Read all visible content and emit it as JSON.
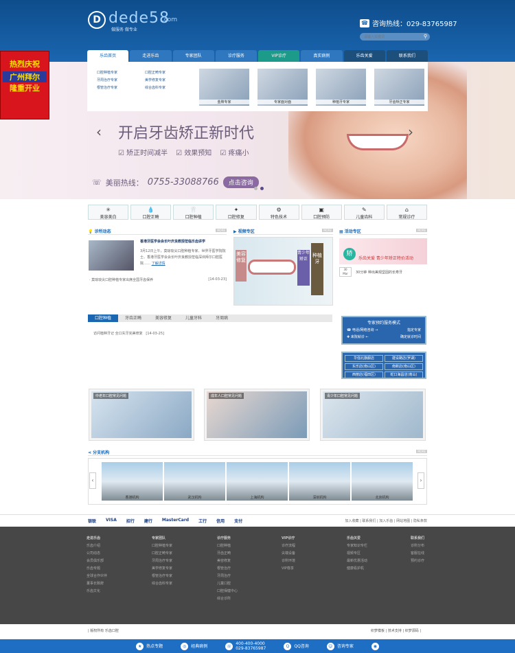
{
  "header": {
    "logo_mark": "D",
    "logo_text": "dede58",
    "logo_domain": ".com",
    "logo_slogan": "做服务 做专业",
    "hotline_label": "咨询热线：029-83765987",
    "search_placeholder": "请输入关键词"
  },
  "nav": [
    "乐齿首页",
    "走进乐齿",
    "专家团队",
    "诊疗服务",
    "VIP诊疗",
    "真实病例",
    "乐齿关爱",
    "联系我们"
  ],
  "dropdown": {
    "links": [
      "口腔种植专家",
      "口腔正畸专家",
      "牙周治疗专家",
      "美学修复专家",
      "根管治疗专家",
      "综合齿科专家"
    ],
    "images": [
      "金牌专家",
      "专家面对面",
      "种植牙专家",
      "牙齿矫正专家"
    ]
  },
  "side_ad": {
    "line1": "热烈庆祝",
    "line2": "广州拜尔",
    "line3": "隆重开业"
  },
  "banner": {
    "title": "开启牙齿矫正新时代",
    "features": [
      "矫正时间减半",
      "效果预知",
      "疼痛小"
    ],
    "hot_label": "美丽热线：",
    "hot_number": "0755-33088766",
    "consult": "点击咨询"
  },
  "services": [
    {
      "icon": "✳",
      "label": "美容美白"
    },
    {
      "icon": "💧",
      "label": "口腔正畸"
    },
    {
      "icon": "🦷",
      "label": "口腔种植"
    },
    {
      "icon": "✦",
      "label": "口腔修复"
    },
    {
      "icon": "⚙",
      "label": "特色技术"
    },
    {
      "icon": "▣",
      "label": "口腔预防"
    },
    {
      "icon": "✎",
      "label": "儿童齿科"
    },
    {
      "icon": "⌂",
      "label": "常规诊疗"
    }
  ],
  "sections": {
    "news": "诊所动态",
    "video": "视频专区",
    "activity": "活动专区",
    "branches": "分支机构",
    "more": "MORE"
  },
  "news": {
    "title": "香港牙医学会会长叶庆良教授莅临乐齿讲学",
    "body": "3月12日上午，莫琼琰尖口腔种植专家、世界牙医学院院士、香港牙医学会会长叶庆良教授莅临深圳拜尔口腔医院……",
    "more": "了解详情",
    "item": "· 莫琼琰尖口腔种植专家出席全国牙齿保养",
    "item_date": "[14-03-23]"
  },
  "video": {
    "left": "美容修复",
    "mid": "青少年矫正",
    "right": "种植牙"
  },
  "activity": {
    "tag": "矫",
    "caption": "乐齿关爱 青少年矫正特价活动",
    "day": "30",
    "month": "Mar",
    "text": "30分钟 种出美观坚固的长寿牙"
  },
  "tabs": [
    "口腔种植",
    "牙齿正畸",
    "美容修复",
    "儿童牙科",
    "牙周病"
  ],
  "tab_item": "访问植种牙记 全口失牙完美修复",
  "tab_item_date": "[14-03-25]",
  "bluebox": {
    "title": "专家预约服务模式",
    "r1a": "电话/网络咨询",
    "r1b": "指定专家",
    "r2a": "来院就诊",
    "r2b": "确定就诊时间"
  },
  "locations": [
    "华强北旗舰店",
    "建设路店(罗湖)",
    "东乐店(南山区)",
    "南新店(南山区)",
    "西丽店(福田区)",
    "蛇口海昌店(南山)"
  ],
  "faq": [
    "中老年口腔常见问题",
    "成年人口腔常见问题",
    "青少年口腔常见问题"
  ],
  "branch_list": [
    "香港机构",
    "武汉机构",
    "上海机构",
    "深圳机构",
    "北京机构"
  ],
  "paybar": {
    "icons": [
      "银联",
      "VISA",
      "招行",
      "建行",
      "MasterCard",
      "工行",
      "信用",
      "支付"
    ],
    "links": "加入收藏 | 联系我们 | 加入乐齿 | 网站地图 | 隐私条款"
  },
  "footer": [
    {
      "head": "走进乐齿",
      "items": [
        "乐齿介绍",
        "公司动态",
        "会员俱乐部",
        "乐齿专题",
        "全球合作伙伴",
        "董事长致辞",
        "乐齿文化"
      ]
    },
    {
      "head": "专家团队",
      "items": [
        "口腔种植专家",
        "口腔正畸专家",
        "牙周治疗专家",
        "美学修复专家",
        "根管治疗专家",
        "综合齿科专家"
      ]
    },
    {
      "head": "诊疗服务",
      "items": [
        "口腔种植",
        "牙齿正畸",
        "美容修复",
        "根管治疗",
        "牙周治疗",
        "儿童口腔",
        "口腔保健中心",
        "综合诊所"
      ]
    },
    {
      "head": "VIP诊疗",
      "items": [
        "诊疗流程",
        "尖端设备",
        "诊所环境",
        "VIP尊享"
      ]
    },
    {
      "head": "乐齿关爱",
      "items": [
        "专家知识专栏",
        "视频专区",
        "最新优惠活动",
        "健康看护机"
      ]
    },
    {
      "head": "联系我们",
      "items": [
        "诊所分布",
        "客服在线",
        "预约诊疗"
      ]
    }
  ],
  "copyright": "| 版权所有 乐齿口腔",
  "copyright_right": "织梦模板 | 技术支持 | 织梦源码 |",
  "bottombar": [
    {
      "icon": "★",
      "label": "热点专题"
    },
    {
      "icon": "◎",
      "label": "经典病例"
    },
    {
      "icon": "☏",
      "label": "400-400-4000\n029-83765987"
    },
    {
      "icon": "Q",
      "label": "QQ咨询"
    },
    {
      "icon": "☺",
      "label": "咨询专家"
    },
    {
      "icon": "◉",
      "label": ""
    }
  ]
}
